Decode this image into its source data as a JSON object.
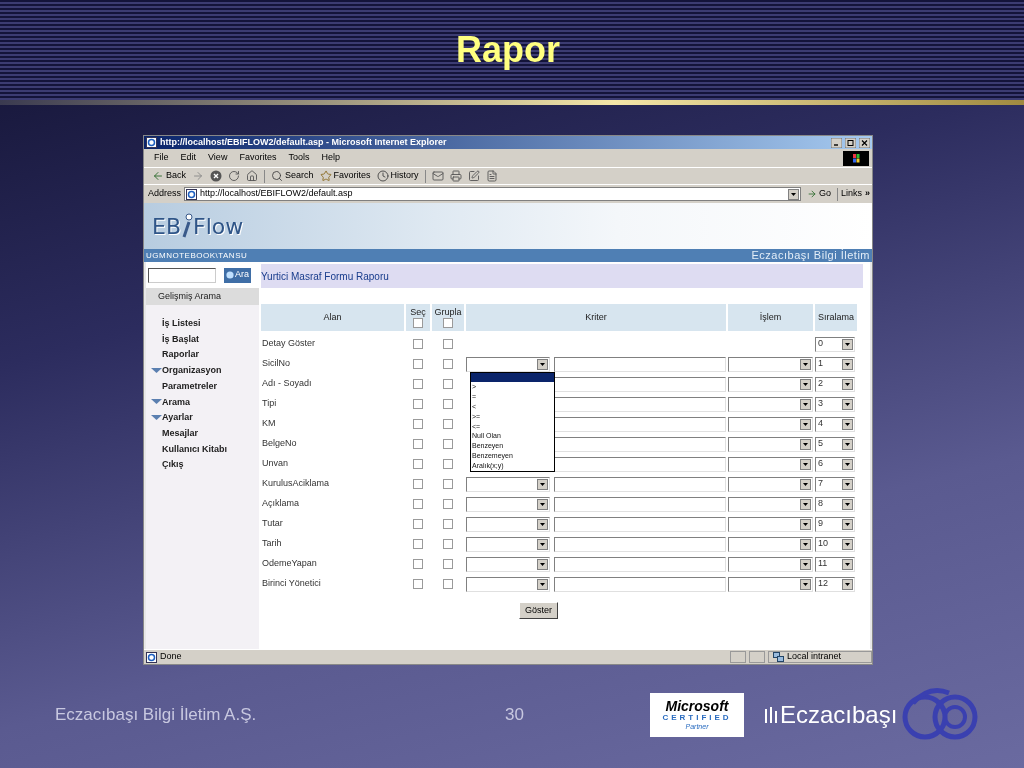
{
  "slide": {
    "title": "Rapor",
    "footer_company": "Eczacıbaşı Bilgi İletim A.Ş.",
    "page_number": "30",
    "ms_logo": {
      "brand": "Microsoft",
      "line": "CERTIFIED",
      "sub": "Partner"
    },
    "company_logo": {
      "text": "Eczacıbaşı"
    }
  },
  "browser": {
    "title": "http://localhost/EBIFLOW2/default.asp - Microsoft Internet Explorer",
    "menu": [
      "File",
      "Edit",
      "View",
      "Favorites",
      "Tools",
      "Help"
    ],
    "toolbar": [
      {
        "kind": "back",
        "label": "Back"
      },
      {
        "kind": "forward"
      },
      {
        "kind": "stop"
      },
      {
        "kind": "refresh"
      },
      {
        "kind": "home"
      },
      {
        "kind": "search",
        "label": "Search"
      },
      {
        "kind": "favorites",
        "label": "Favorites"
      },
      {
        "kind": "history",
        "label": "History"
      },
      {
        "kind": "mail"
      },
      {
        "kind": "print"
      },
      {
        "kind": "edit"
      },
      {
        "kind": "discuss"
      }
    ],
    "address": {
      "label": "Address",
      "url": "http://localhost/EBIFLOW2/default.asp",
      "go": "Go",
      "links": "Links",
      "more": "»"
    },
    "status": {
      "text": "Done",
      "zone": "Local intranet"
    }
  },
  "app": {
    "logo": [
      "EB",
      "Flow"
    ],
    "user": "UGMNOTEBOOK\\TANSU",
    "company": "Eczacıbaşı Bilgi İletim",
    "search_button": "Ara",
    "advanced_search": "Gelişmiş Arama",
    "nav": [
      {
        "label": "İş Listesi",
        "expandable": false
      },
      {
        "label": "İş Başlat",
        "expandable": false
      },
      {
        "label": "Raporlar",
        "expandable": false
      },
      {
        "label": "Organizasyon",
        "expandable": true
      },
      {
        "label": "Parametreler",
        "expandable": false
      },
      {
        "label": "Arama",
        "expandable": true
      },
      {
        "label": "Ayarlar",
        "expandable": true
      },
      {
        "label": "Mesajlar",
        "expandable": false
      },
      {
        "label": "Kullanıcı Kitabı",
        "expandable": false
      },
      {
        "label": "Çıkış",
        "expandable": false
      }
    ],
    "report_title": "Yurtici Masraf Formu Raporu",
    "columns": [
      {
        "kind": "text",
        "label": "Alan"
      },
      {
        "kind": "checkbox",
        "label": "Seç",
        "checked": false
      },
      {
        "kind": "checkbox",
        "label": "Grupla",
        "checked": false
      },
      {
        "kind": "text",
        "label": "Kriter"
      },
      {
        "kind": "text",
        "label": "İşlem"
      },
      {
        "kind": "text",
        "label": "Sıralama"
      }
    ],
    "rows": [
      {
        "kind": "detail",
        "label": "Detay Göster",
        "select": false,
        "group": false,
        "order": "0"
      },
      {
        "kind": "field_open",
        "label": "SicilNo",
        "select": false,
        "group": false,
        "order": "1"
      },
      {
        "kind": "field_under_list",
        "label": "Adı - Soyadı",
        "select": false,
        "group": false,
        "order": "2"
      },
      {
        "kind": "field_under_list",
        "label": "Tipi",
        "select": false,
        "group": false,
        "order": "3"
      },
      {
        "kind": "field_under_list",
        "label": "KM",
        "select": false,
        "group": false,
        "order": "4"
      },
      {
        "kind": "field_under_list",
        "label": "BelgeNo",
        "select": false,
        "group": false,
        "order": "5"
      },
      {
        "kind": "field_under_list",
        "label": "Unvan",
        "select": false,
        "group": false,
        "order": "6"
      },
      {
        "kind": "field",
        "label": "KurulusAciklama",
        "select": false,
        "group": false,
        "order": "7"
      },
      {
        "kind": "field",
        "label": "Açıklama",
        "select": false,
        "group": false,
        "order": "8"
      },
      {
        "kind": "field",
        "label": "Tutar",
        "select": false,
        "group": false,
        "order": "9"
      },
      {
        "kind": "field",
        "label": "Tarih",
        "select": false,
        "group": false,
        "order": "10"
      },
      {
        "kind": "field",
        "label": "OdemeYapan",
        "select": false,
        "group": false,
        "order": "11"
      },
      {
        "kind": "field",
        "label": "Birinci Yönetici",
        "select": false,
        "group": false,
        "order": "12"
      }
    ],
    "operator_list": {
      "blank_highlighted": true,
      "options": [
        ">",
        "=",
        "<",
        ">=",
        "<=",
        "Null Olan",
        "Benzeyen",
        "Benzemeyen",
        "Aralık(x;y)"
      ]
    },
    "submit": "Göster"
  }
}
